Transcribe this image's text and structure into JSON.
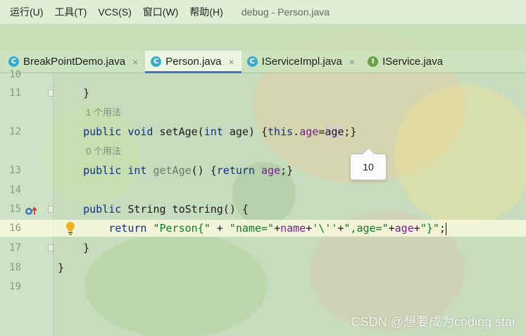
{
  "menu": {
    "items": [
      "运行(U)",
      "工具(T)",
      "VCS(S)",
      "窗口(W)",
      "帮助(H)"
    ],
    "window_title": "debug - Person.java"
  },
  "tabs": [
    {
      "label": "BreakPointDemo.java",
      "icon": "class-icon",
      "icon_glyph": "C",
      "active": false
    },
    {
      "label": "Person.java",
      "icon": "class-icon",
      "icon_glyph": "C",
      "active": true
    },
    {
      "label": "IServiceImpl.java",
      "icon": "class-icon",
      "icon_glyph": "C",
      "active": false
    },
    {
      "label": "IService.java",
      "icon": "interface-icon",
      "icon_glyph": "I",
      "active": false
    }
  ],
  "tab_close_glyph": "×",
  "editor": {
    "line_numbers": [
      "10",
      "11",
      "12",
      "13",
      "14",
      "15",
      "16",
      "17",
      "18",
      "19"
    ],
    "usage_hint_1": "1 个用法",
    "usage_hint_0": "0 个用法",
    "code": {
      "l11": "    }",
      "l12_pre": "    ",
      "l12_public": "public",
      "l12_void": "void",
      "l12_name": " setAge(",
      "l12_int": "int",
      "l12_param": " age) {",
      "l12_this": "this",
      "l12_dot": ".",
      "l12_field": "age",
      "l12_eq": "=",
      "l12_val": "age",
      "l12_end": ";}",
      "l13_public": "public",
      "l13_int": "int",
      "l13_name": " getAge",
      "l13_mid": "() {",
      "l13_return": "return",
      "l13_field": "age",
      "l13_end": ";}",
      "l15_public": "public",
      "l15_rest": " String toString() {",
      "l16_return": "return",
      "l16_s1": "\"Person{\"",
      "l16_p1": " + ",
      "l16_s2": "\"name=\"",
      "l16_p2": "+",
      "l16_f1": "name",
      "l16_p3": "+",
      "l16_s3": "'\\''",
      "l16_p4": "+",
      "l16_s4": "\",age=\"",
      "l16_p5": "+",
      "l16_f2": "age",
      "l16_p6": "+",
      "l16_s5": "\"}\"",
      "l16_end": ";",
      "l17": "    }",
      "l18": "}"
    },
    "tooltip_value": "10"
  },
  "watermark": "CSDN @想要成为coding star",
  "colors": {
    "keyword": "#0d2f8a",
    "field": "#7a1e8c",
    "string": "#0f7a23",
    "active_tab_underline": "#3d74c8"
  }
}
